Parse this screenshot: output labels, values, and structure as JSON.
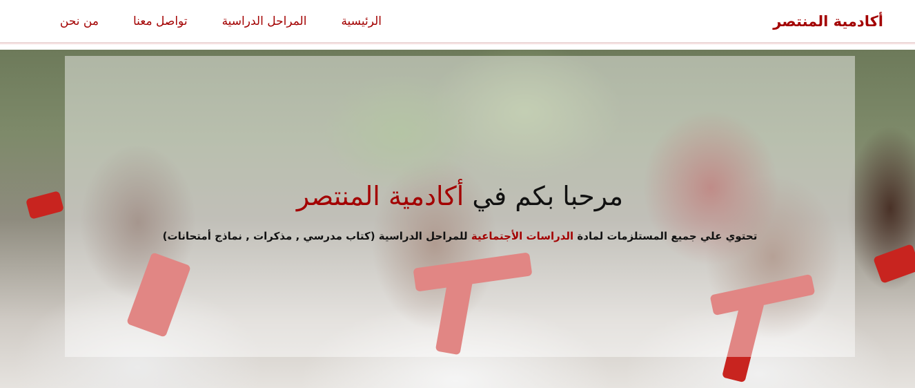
{
  "navbar": {
    "brand": "أكادمية المنتصر",
    "links": [
      {
        "label": "الرئيسية"
      },
      {
        "label": "المراحل الدراسية"
      },
      {
        "label": "تواصل معنا"
      },
      {
        "label": "من نحن"
      }
    ]
  },
  "hero": {
    "title_prefix": "مرحبا بكم في ",
    "title_accent": "أكادمية المنتصر",
    "subtitle_prefix": "تحتوي علي جميع المستلزمات لمادة ",
    "subtitle_accent": "الدراسات الأجتماعية",
    "subtitle_suffix": " للمراحل الدراسية (كتاب مدرسي , مذكرات , نماذج أمتحانات)",
    "background_image": "students-waving-photo"
  },
  "colors": {
    "accent": "#a30000",
    "text": "#111111",
    "navbar_bg": "#ffffff"
  }
}
